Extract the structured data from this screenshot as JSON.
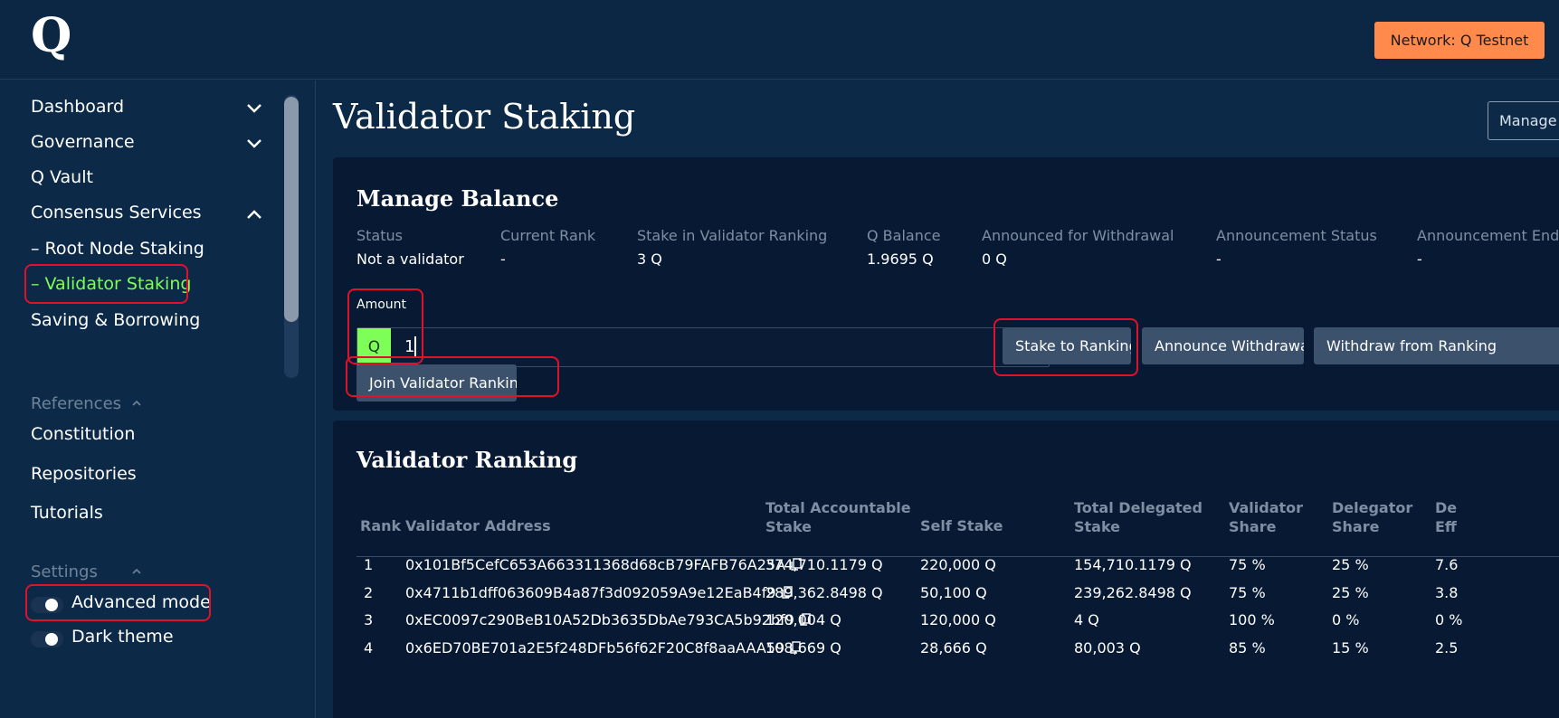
{
  "header": {
    "logo": "Q",
    "network_label": "Network: Q Testnet"
  },
  "sidebar": {
    "items": [
      {
        "label": "Dashboard",
        "chevron": "chevron-down-icon"
      },
      {
        "label": "Governance",
        "chevron": "chevron-down-icon"
      },
      {
        "label": "Q Vault"
      },
      {
        "label": "Consensus Services",
        "chevron": "chevron-up-icon"
      },
      {
        "label": "– Root Node Staking"
      },
      {
        "label": "– Validator Staking",
        "active": true
      },
      {
        "label": "Saving & Borrowing"
      }
    ],
    "references_label": "References",
    "references": [
      "Constitution",
      "Repositories",
      "Tutorials"
    ],
    "settings_label": "Settings",
    "settings": [
      {
        "label": "Advanced mode",
        "on": true
      },
      {
        "label": "Dark theme",
        "on": true
      }
    ]
  },
  "main": {
    "title": "Validator Staking",
    "manage_button": "Manage",
    "manage_balance": {
      "title": "Manage Balance",
      "stats": [
        {
          "label": "Status",
          "value": "Not a validator"
        },
        {
          "label": "Current Rank",
          "value": "-"
        },
        {
          "label": "Stake in Validator Ranking",
          "value": "3 Q"
        },
        {
          "label": "Q Balance",
          "value": "1.9695 Q"
        },
        {
          "label": "Announced for Withdrawal",
          "value": "0 Q"
        },
        {
          "label": "Announcement Status",
          "value": "-"
        },
        {
          "label": "Announcement End",
          "value": "-"
        }
      ],
      "amount_label": "Amount",
      "amount_prefix": "Q",
      "amount_value": "1",
      "buttons": {
        "stake": "Stake to Ranking",
        "announce": "Announce Withdrawal",
        "withdraw": "Withdraw from Ranking",
        "join": "Join Validator Ranking"
      }
    },
    "ranking": {
      "title": "Validator Ranking",
      "headers": [
        "Rank",
        "Validator Address",
        "Total Accountable\nStake",
        "Self Stake",
        "Total Delegated\nStake",
        "Validator\nShare",
        "Delegator\nShare",
        "De\nEff"
      ],
      "rows": [
        [
          "1",
          "0x101Bf5CefC653A663311368d68cB79FAFB76A25A",
          "374,710.1179 Q",
          "220,000 Q",
          "154,710.1179 Q",
          "75 %",
          "25 %",
          "7.6"
        ],
        [
          "2",
          "0x4711b1dff063609B4a87f3d092059A9e12EaB4f9",
          "289,362.8498 Q",
          "50,100 Q",
          "239,262.8498 Q",
          "75 %",
          "25 %",
          "3.8"
        ],
        [
          "3",
          "0xEC0097c290BeB10A52Db3635DbAe793CA5b92bf9",
          "120,004 Q",
          "120,000 Q",
          "4 Q",
          "100 %",
          "0 %",
          "0 %"
        ],
        [
          "4",
          "0x6ED70BE701a2E5f248DFb56f62F20C8f8aaAAA59",
          "108,669 Q",
          "28,666 Q",
          "80,003 Q",
          "85 %",
          "15 %",
          "2.5"
        ]
      ]
    }
  }
}
